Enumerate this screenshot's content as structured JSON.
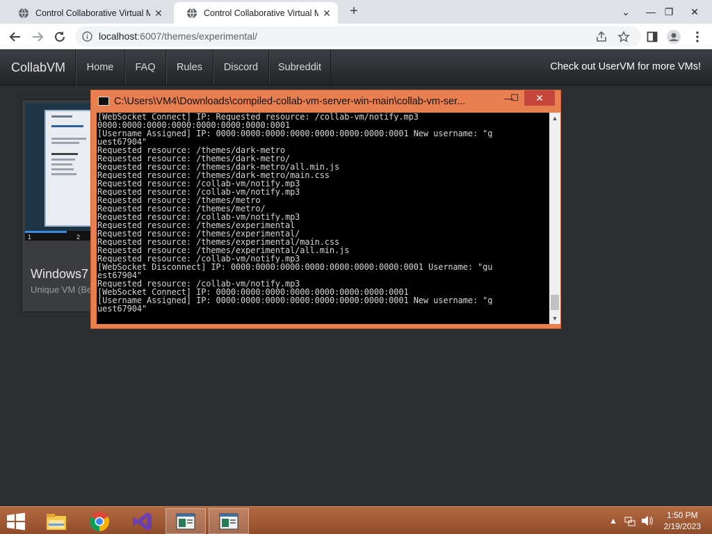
{
  "browser": {
    "tabs": [
      {
        "title": "Control Collaborative Virtual Ma",
        "active": false
      },
      {
        "title": "Control Collaborative Virtual Ma",
        "active": true
      }
    ],
    "new_tab": "+",
    "address": {
      "host": "localhost",
      "rest": ":6007/themes/experimental/"
    }
  },
  "site": {
    "brand": "CollabVM",
    "nav": [
      "Home",
      "FAQ",
      "Rules",
      "Discord",
      "Subreddit"
    ],
    "promo": "Check out UserVM for more VMs!"
  },
  "vm_card": {
    "title": "Windows7",
    "subtitle": "Unique VM (Be",
    "progress_steps": [
      "1",
      "2"
    ]
  },
  "console": {
    "title": "C:\\Users\\VM4\\Downloads\\compiled-collab-vm-server-win-main\\collab-vm-ser...",
    "lines": [
      "[WebSocket Connect] IP: Requested resource: /collab-vm/notify.mp3",
      "0000:0000:0000:0000:0000:0000:0000:0001",
      "[Username Assigned] IP: 0000:0000:0000:0000:0000:0000:0000:0001 New username: \"g",
      "uest67904\"",
      "Requested resource: /themes/dark-metro",
      "Requested resource: /themes/dark-metro/",
      "Requested resource: /themes/dark-metro/all.min.js",
      "Requested resource: /themes/dark-metro/main.css",
      "Requested resource: /collab-vm/notify.mp3",
      "Requested resource: /collab-vm/notify.mp3",
      "Requested resource: /themes/metro",
      "Requested resource: /themes/metro/",
      "Requested resource: /collab-vm/notify.mp3",
      "Requested resource: /themes/experimental",
      "Requested resource: /themes/experimental/",
      "Requested resource: /themes/experimental/main.css",
      "Requested resource: /themes/experimental/all.min.js",
      "Requested resource: /collab-vm/notify.mp3",
      "[WebSocket Disconnect] IP: 0000:0000:0000:0000:0000:0000:0000:0001 Username: \"gu",
      "est67904\"",
      "Requested resource: /collab-vm/notify.mp3",
      "[WebSocket Connect] IP: 0000:0000:0000:0000:0000:0000:0000:0001",
      "[Username Assigned] IP: 0000:0000:0000:0000:0000:0000:0000:0001 New username: \"g",
      "uest67904\""
    ]
  },
  "taskbar": {
    "time": "1:50 PM",
    "date": "2/19/2023"
  },
  "colors": {
    "console_frame": "#e97e4f",
    "console_close": "#c7463b",
    "taskbar": "#a35a36",
    "site_bg": "#2b2d31"
  }
}
